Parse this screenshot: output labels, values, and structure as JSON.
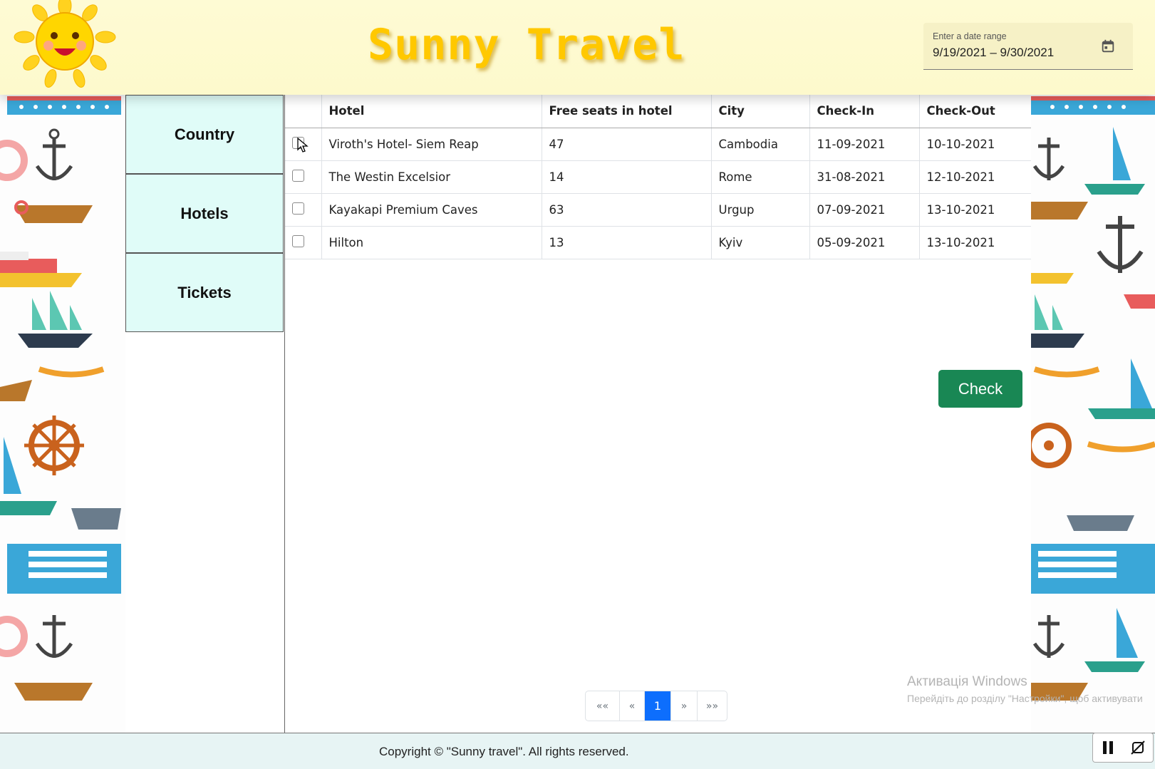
{
  "header": {
    "title": "Sunny Travel",
    "date_range": {
      "label": "Enter a date range",
      "value": "9/19/2021 – 9/30/2021"
    }
  },
  "sidebar": {
    "items": [
      {
        "label": "Country"
      },
      {
        "label": "Hotels"
      },
      {
        "label": "Tickets"
      }
    ]
  },
  "table": {
    "columns": [
      "",
      "Hotel",
      "Free seats in hotel",
      "City",
      "Check-In",
      "Check-Out"
    ],
    "rows": [
      {
        "hotel": "Viroth's Hotel- Siem Reap",
        "seats": "47",
        "city": "Cambodia",
        "checkin": "11-09-2021",
        "checkout": "10-10-2021"
      },
      {
        "hotel": "The Westin Excelsior",
        "seats": "14",
        "city": "Rome",
        "checkin": "31-08-2021",
        "checkout": "12-10-2021"
      },
      {
        "hotel": "Kayakapi Premium Caves",
        "seats": "63",
        "city": "Urgup",
        "checkin": "07-09-2021",
        "checkout": "13-10-2021"
      },
      {
        "hotel": "Hilton",
        "seats": "13",
        "city": "Kyiv",
        "checkin": "05-09-2021",
        "checkout": "13-10-2021"
      }
    ]
  },
  "check_button": "Check",
  "pagination": {
    "first": "««",
    "prev": "«",
    "current": "1",
    "next": "»",
    "last": "»»"
  },
  "watermark": {
    "title": "Активація Windows",
    "subtitle": "Перейдіть до розділу \"Настройки\", щоб активувати"
  },
  "footer": {
    "copyright": "Copyright © \"Sunny travel\". All rights reserved."
  },
  "colors": {
    "accent_green": "#198754",
    "pager_active": "#0d6efd",
    "sidebar_bg": "#e0fcf8",
    "title": "#ffc800"
  }
}
